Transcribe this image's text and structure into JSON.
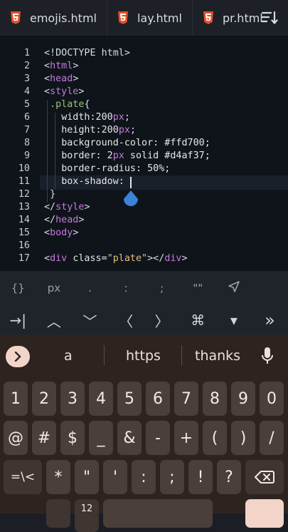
{
  "tabs": [
    {
      "label": "emojis.html"
    },
    {
      "label": "lay.html"
    },
    {
      "label": "pr.html"
    }
  ],
  "icons": {
    "file": "html5-icon",
    "sort": "sort-icon",
    "cursor_handle": "text-cursor-handle-icon",
    "send": "send-icon",
    "mic": "microphone-icon",
    "backspace": "backspace-icon"
  },
  "colors": {
    "html5": "#e44d26",
    "tag": "#c678dd",
    "selector": "#98c379",
    "string": "#e5c07b",
    "key_accent": "#f2d4c9"
  },
  "editor": {
    "lines": [
      {
        "n": "1",
        "text": "<!DOCTYPE html>"
      },
      {
        "n": "2",
        "text": "<html>"
      },
      {
        "n": "3",
        "text": "<head>"
      },
      {
        "n": "4",
        "text": "<style>"
      },
      {
        "n": "5",
        "text": ".plate{"
      },
      {
        "n": "6",
        "text": "width:200px;"
      },
      {
        "n": "7",
        "text": "height:200px;"
      },
      {
        "n": "8",
        "text": "background-color: #ffd700;"
      },
      {
        "n": "9",
        "text": "border: 2px solid #d4af37;"
      },
      {
        "n": "10",
        "text": "border-radius: 50%;"
      },
      {
        "n": "11",
        "text": "box-shadow: "
      },
      {
        "n": "12",
        "text": "}"
      },
      {
        "n": "13",
        "text": "</style>"
      },
      {
        "n": "14",
        "text": "</head>"
      },
      {
        "n": "15",
        "text": "<body>"
      },
      {
        "n": "16",
        "text": ""
      },
      {
        "n": "17",
        "text": "<div class=\"plate\"></div>"
      }
    ]
  },
  "symbol_bar": [
    "{}",
    "px",
    ".",
    ":",
    ";",
    "\"\""
  ],
  "nav_bar": {
    "tab": "→|",
    "up": "︿",
    "down": "﹀",
    "left": "〈",
    "right": "〉",
    "cmd": "⌘",
    "drop": "▾",
    "end": "»"
  },
  "keyboard": {
    "suggestions": [
      "a",
      "https",
      "thanks"
    ],
    "row1": [
      "1",
      "2",
      "3",
      "4",
      "5",
      "6",
      "7",
      "8",
      "9",
      "0"
    ],
    "row2": [
      "@",
      "#",
      "$",
      "_",
      "&",
      "-",
      "+",
      "(",
      ")",
      "/"
    ],
    "row3": [
      "=\\<",
      "*",
      "\"",
      "'",
      ":",
      ";",
      "!",
      "?"
    ],
    "row4_label": "12"
  }
}
